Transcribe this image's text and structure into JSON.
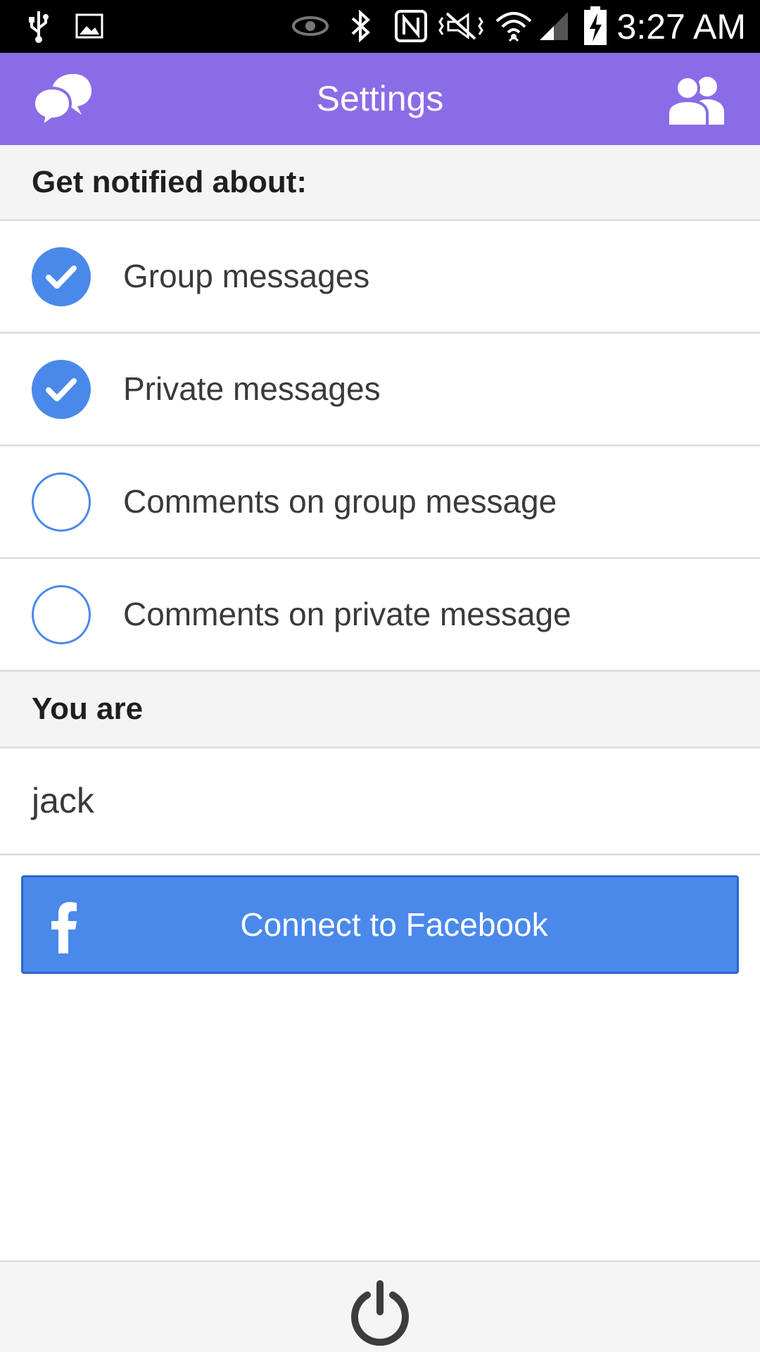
{
  "status_bar": {
    "time": "3:27 AM",
    "icons": [
      "usb-icon",
      "image-icon",
      "eye-icon",
      "bluetooth-icon",
      "nfc-icon",
      "vibrate-icon",
      "wifi-icon",
      "signal-icon",
      "battery-charging-icon"
    ]
  },
  "app_bar": {
    "title": "Settings",
    "left_icon": "chat-bubbles-icon",
    "right_icon": "users-icon",
    "color": "#8a6ce6"
  },
  "notifications": {
    "header": "Get notified about:",
    "options": [
      {
        "label": "Group messages",
        "checked": true
      },
      {
        "label": "Private messages",
        "checked": true
      },
      {
        "label": "Comments on group message",
        "checked": false
      },
      {
        "label": "Comments on private message",
        "checked": false
      }
    ],
    "accent": "#4a89ea"
  },
  "identity": {
    "header": "You are",
    "username": "jack"
  },
  "facebook": {
    "label": "Connect to Facebook",
    "icon": "facebook-icon",
    "color": "#4a89ea"
  },
  "bottom_bar": {
    "icon": "power-icon"
  }
}
